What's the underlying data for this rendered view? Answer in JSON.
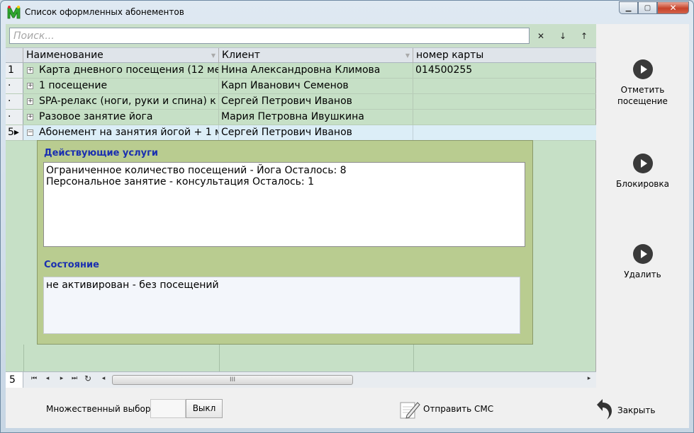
{
  "window": {
    "title": "Список оформленных абонементов",
    "minimize": "▁",
    "maximize": "▢",
    "close": "✕"
  },
  "search": {
    "placeholder": "Поиск...",
    "clear": "✕",
    "down": "↓",
    "up": "↑"
  },
  "grid": {
    "columns": [
      "Наименование",
      "Клиент",
      "номер карты"
    ],
    "rows": [
      {
        "indicator": "1",
        "name": "Карта дневного посещения (12 ме",
        "client": "Нина Александровна Климова",
        "card": "014500255"
      },
      {
        "indicator": "·",
        "name": "1 посещение",
        "client": "Карп Иванович Семенов",
        "card": ""
      },
      {
        "indicator": "·",
        "name": "SPA-релакс (ноги, руки и спина) к",
        "client": "Сергей Петрович Иванов",
        "card": ""
      },
      {
        "indicator": "·",
        "name": "Разовое занятие йога",
        "client": "Мария Петровна Ивушкина",
        "card": ""
      },
      {
        "indicator": "5▸",
        "name": "Абонемент на занятия йогой + 1 м",
        "client": "Сергей Петрович Иванов",
        "card": ""
      }
    ]
  },
  "detail": {
    "services_label": "Действующие услуги",
    "services": [
      "Ограниченное количество посещений - Йога Осталось: 8",
      "Персональное занятие - консультация Осталось: 1"
    ],
    "status_label": "Состояние",
    "status_value": "не активирован - без посещений"
  },
  "navigator": {
    "count": "5",
    "first": "⏮",
    "prev": "◂",
    "next": "▸",
    "last": "⏭",
    "refresh": "↻",
    "scroll_left": "◂",
    "scroll_right": "▸",
    "thumb_grip": "III"
  },
  "side_actions": [
    {
      "label_line1": "Отметить",
      "label_line2": "посещение"
    },
    {
      "label_line1": "Блокировка",
      "label_line2": ""
    },
    {
      "label_line1": "Удалить",
      "label_line2": ""
    }
  ],
  "bottom": {
    "multi_label": "Множественный выбор",
    "multi_button": "Выкл",
    "sms_label": "Отправить СМС",
    "close_label": "Закрыть"
  },
  "colors": {
    "grid_background": "#c6e0c6",
    "detail_background": "#b9cc90",
    "detail_label": "#1a2fb0",
    "selected_row": "#dceef7"
  }
}
